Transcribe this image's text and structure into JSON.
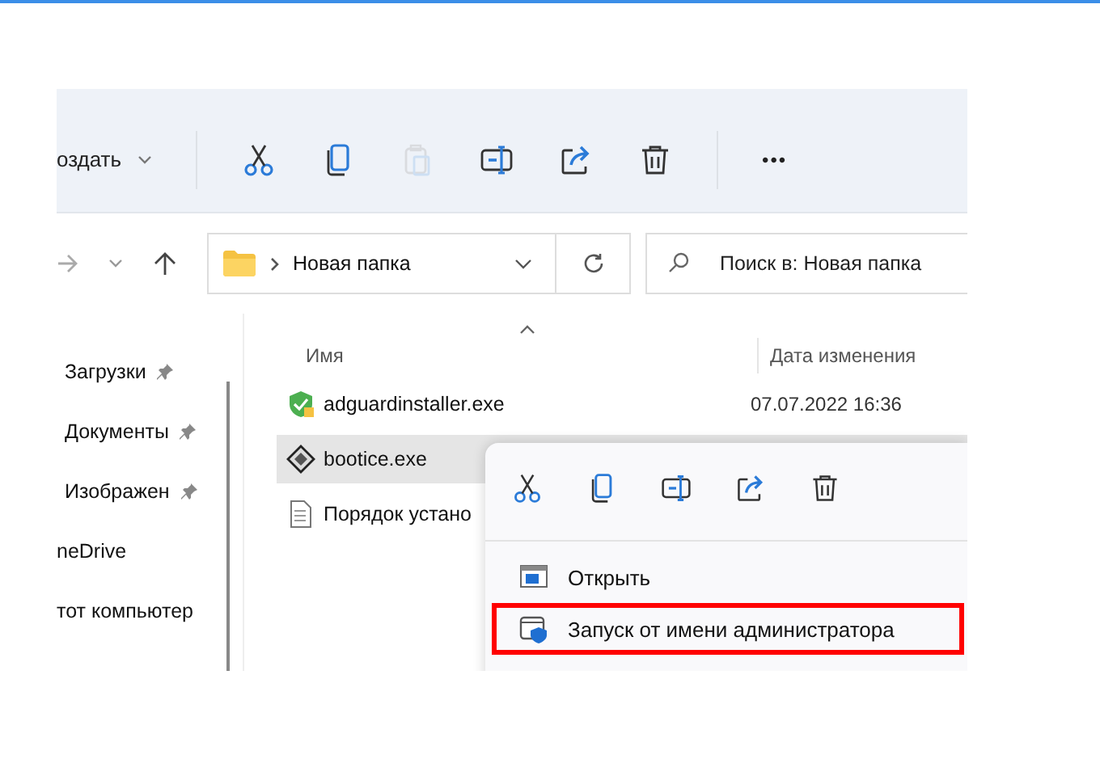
{
  "toolbar": {
    "new_label": "оздать",
    "actions": [
      {
        "kind": "cut",
        "disabled": false
      },
      {
        "kind": "copy",
        "disabled": false
      },
      {
        "kind": "paste",
        "disabled": true
      },
      {
        "kind": "rename",
        "disabled": false
      },
      {
        "kind": "share",
        "disabled": false
      },
      {
        "kind": "delete",
        "disabled": false
      }
    ],
    "more": "•••"
  },
  "address": {
    "path": "Новая папка",
    "search_placeholder": "Поиск в: Новая папка"
  },
  "sidebar": {
    "items": [
      {
        "label": "Загрузки",
        "pinned": true
      },
      {
        "label": "Документы",
        "pinned": true
      },
      {
        "label": "Изображен",
        "pinned": true
      },
      {
        "label": "neDrive",
        "pinned": false
      },
      {
        "label": "тот компьютер",
        "pinned": false
      }
    ]
  },
  "table": {
    "columns": [
      "Имя",
      "Дата изменения"
    ],
    "rows": [
      {
        "kind": "shield",
        "name": "adguardinstaller.exe",
        "date": "07.07.2022 16:36",
        "selected": false
      },
      {
        "kind": "app",
        "name": "bootice.exe",
        "date": "",
        "selected": true
      },
      {
        "kind": "text",
        "name": "Порядок устано",
        "date": "",
        "selected": false
      }
    ]
  },
  "context_menu": {
    "actions": [
      {
        "kind": "cut"
      },
      {
        "kind": "copy"
      },
      {
        "kind": "rename"
      },
      {
        "kind": "share"
      },
      {
        "kind": "delete"
      }
    ],
    "items": [
      {
        "kind": "open",
        "label": "Открыть",
        "highlighted": false
      },
      {
        "kind": "admin",
        "label": "Запуск от имени администратора",
        "highlighted": true
      }
    ]
  }
}
